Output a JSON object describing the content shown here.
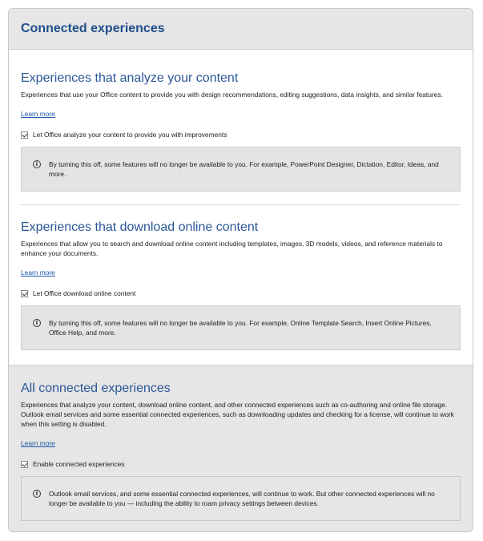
{
  "header": {
    "title": "Connected experiences"
  },
  "sections": [
    {
      "title": "Experiences that analyze your content",
      "description": "Experiences that use your Office content to provide you with design recommendations, editing suggestions, data insights, and similar features.",
      "learn_more": "Learn more",
      "checkbox_label": "Let Office analyze your content to provide you with improvements",
      "checked": true,
      "info": "By turning this off, some features will no longer be available to you. For example, PowerPoint Designer, Dictation, Editor, Ideas, and more."
    },
    {
      "title": "Experiences that download online content",
      "description": "Experiences that allow you to search and download online content including templates, images, 3D models, videos, and reference materials to enhance your documents.",
      "learn_more": "Learn more",
      "checkbox_label": "Let Office download online content",
      "checked": true,
      "info": "By turning this off, some features will no longer be available to you. For example, Online Template Search, Insert Online Pictures, Office Help, and more."
    },
    {
      "title": "All connected experiences",
      "description": "Experiences that analyze your content, download online content, and other connected experiences such as co-authoring and online file storage. Outlook email services and some essential connected experiences, such as downloading updates and checking for a license, will continue to work when this setting is disabled.",
      "learn_more": "Learn more",
      "checkbox_label": "Enable connected experiences",
      "checked": true,
      "info": "Outlook email services, and some essential connected experiences, will continue to work. But other connected experiences will no longer be available to you — including the ability to roam privacy settings between devices."
    }
  ],
  "icons": {
    "info": "info-circle-icon",
    "check": "checkmark-icon"
  },
  "colors": {
    "title": "#1f4e8c",
    "link": "#1a56a8",
    "panel": "#e6e6e6"
  }
}
